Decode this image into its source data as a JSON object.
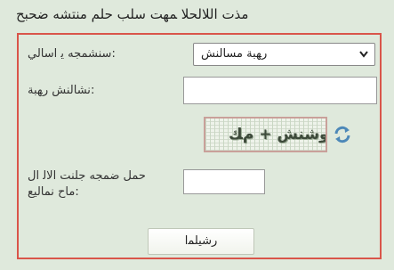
{
  "page": {
    "title": "ﻣﺬﺕ ﺍﻟﻼﻟﺤﻼ ﻤﻬﺖ ﺳﻠﺐ ﺣﻠﻢ ﻣﻨﺘﺸﻪ ﺿﺤﺒﺢ"
  },
  "form": {
    "type_label": "ﺳﻨﺸﻤﺠﻪ ﻳ ﺍﺳﺎﻟﻲ:",
    "type_selected": "ﺭﻬﺒﺔ ﻣﺴﺎﻟﻨﺶ",
    "number_label": "ﻧﺸﺎﻟﻨﺶ ﺭﻬﺒﺔ:",
    "number_value": "",
    "captcha_text": "ﺭﻭﺷﻨﺶ + ﻡﻚ",
    "captcha_label_line1": "ﺣﻤﻞ ﺿﻤﺠﻪ ﺟﻠﻨﺖ ﺍﻟﺎﻟ ﺍﻝ",
    "captcha_label_line2": "ﻣﺎﺡ ﻧﻤﺎﻟﻴﻊ:",
    "captcha_answer": "",
    "submit_label": "ﺭﺷﻴﻠﻤﺍ"
  },
  "colors": {
    "background": "#dfe9dc",
    "panel_border": "#d9554a"
  },
  "icons": {
    "refresh": "refresh-icon",
    "dropdown": "chevron-down-icon"
  }
}
